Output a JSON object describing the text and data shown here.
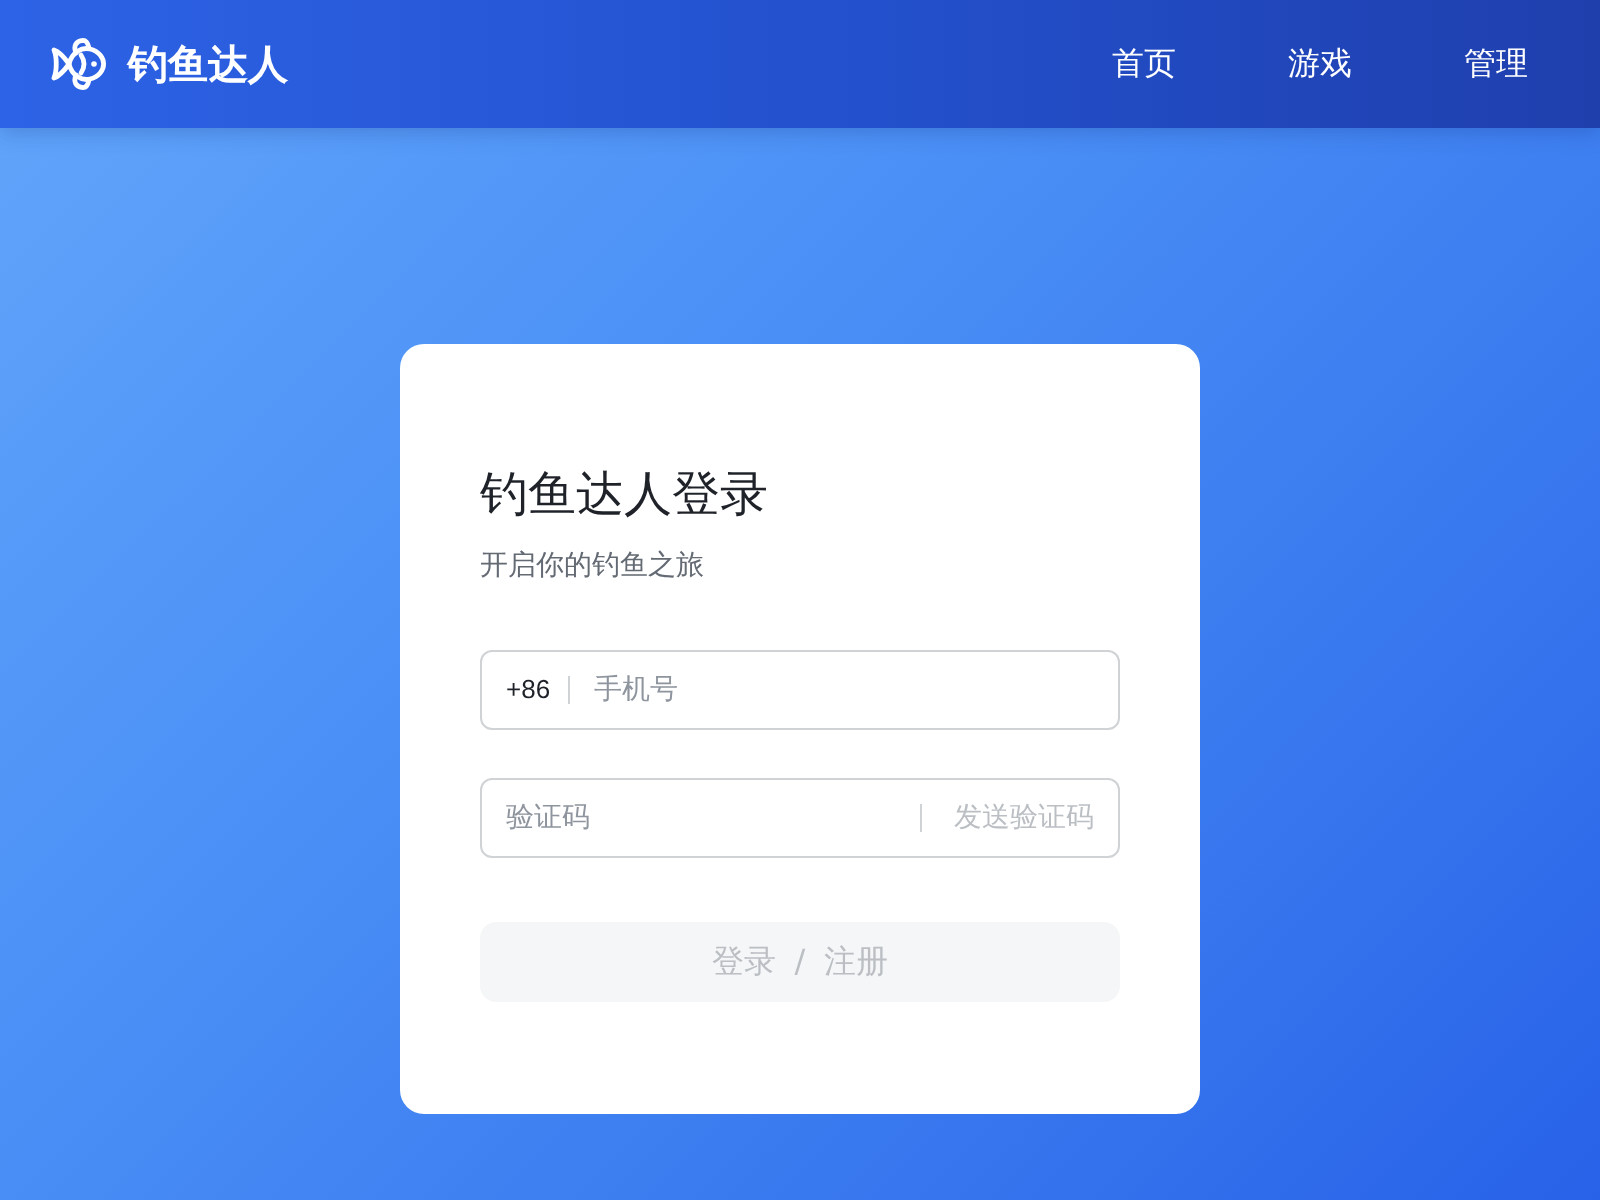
{
  "header": {
    "logo_text": "钓鱼达人",
    "nav": [
      {
        "label": "首页"
      },
      {
        "label": "游戏"
      },
      {
        "label": "管理"
      }
    ]
  },
  "login_card": {
    "title": "钓鱼达人登录",
    "subtitle": "开启你的钓鱼之旅",
    "phone_field": {
      "prefix": "+86",
      "placeholder": "手机号"
    },
    "code_field": {
      "placeholder": "验证码",
      "send_button": {
        "label": "发送验证码",
        "disabled": true
      }
    },
    "submit_button": {
      "label": "登录 / 注册",
      "disabled": true
    }
  }
}
